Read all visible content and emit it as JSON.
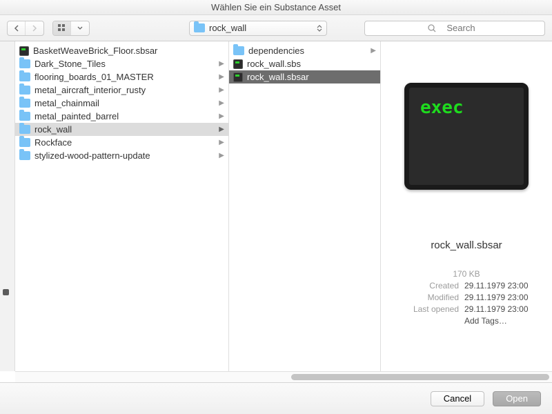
{
  "title": "Wählen Sie ein Substance Asset",
  "toolbar": {
    "path_label": "rock_wall",
    "search_placeholder": "Search"
  },
  "col1": [
    {
      "name": "BasketWeaveBrick_Floor.sbsar",
      "type": "file",
      "has_children": false
    },
    {
      "name": "Dark_Stone_Tiles",
      "type": "folder",
      "has_children": true
    },
    {
      "name": "flooring_boards_01_MASTER",
      "type": "folder",
      "has_children": true
    },
    {
      "name": "metal_aircraft_interior_rusty",
      "type": "folder",
      "has_children": true
    },
    {
      "name": "metal_chainmail",
      "type": "folder",
      "has_children": true
    },
    {
      "name": "metal_painted_barrel",
      "type": "folder",
      "has_children": true
    },
    {
      "name": "rock_wall",
      "type": "folder",
      "has_children": true,
      "selected": "path"
    },
    {
      "name": "Rockface",
      "type": "folder",
      "has_children": true
    },
    {
      "name": "stylized-wood-pattern-update",
      "type": "folder",
      "has_children": true
    }
  ],
  "col2": [
    {
      "name": "dependencies",
      "type": "folder",
      "has_children": true
    },
    {
      "name": "rock_wall.sbs",
      "type": "file",
      "has_children": false
    },
    {
      "name": "rock_wall.sbsar",
      "type": "file",
      "has_children": false,
      "selected": "active"
    }
  ],
  "preview": {
    "thumb_text": "exec",
    "filename": "rock_wall.sbsar",
    "size": "170 KB",
    "created_label": "Created",
    "created_value": "29.11.1979 23:00",
    "modified_label": "Modified",
    "modified_value": "29.11.1979 23:00",
    "lastopened_label": "Last opened",
    "lastopened_value": "29.11.1979 23:00",
    "add_tags": "Add Tags…"
  },
  "footer": {
    "cancel": "Cancel",
    "open": "Open"
  }
}
